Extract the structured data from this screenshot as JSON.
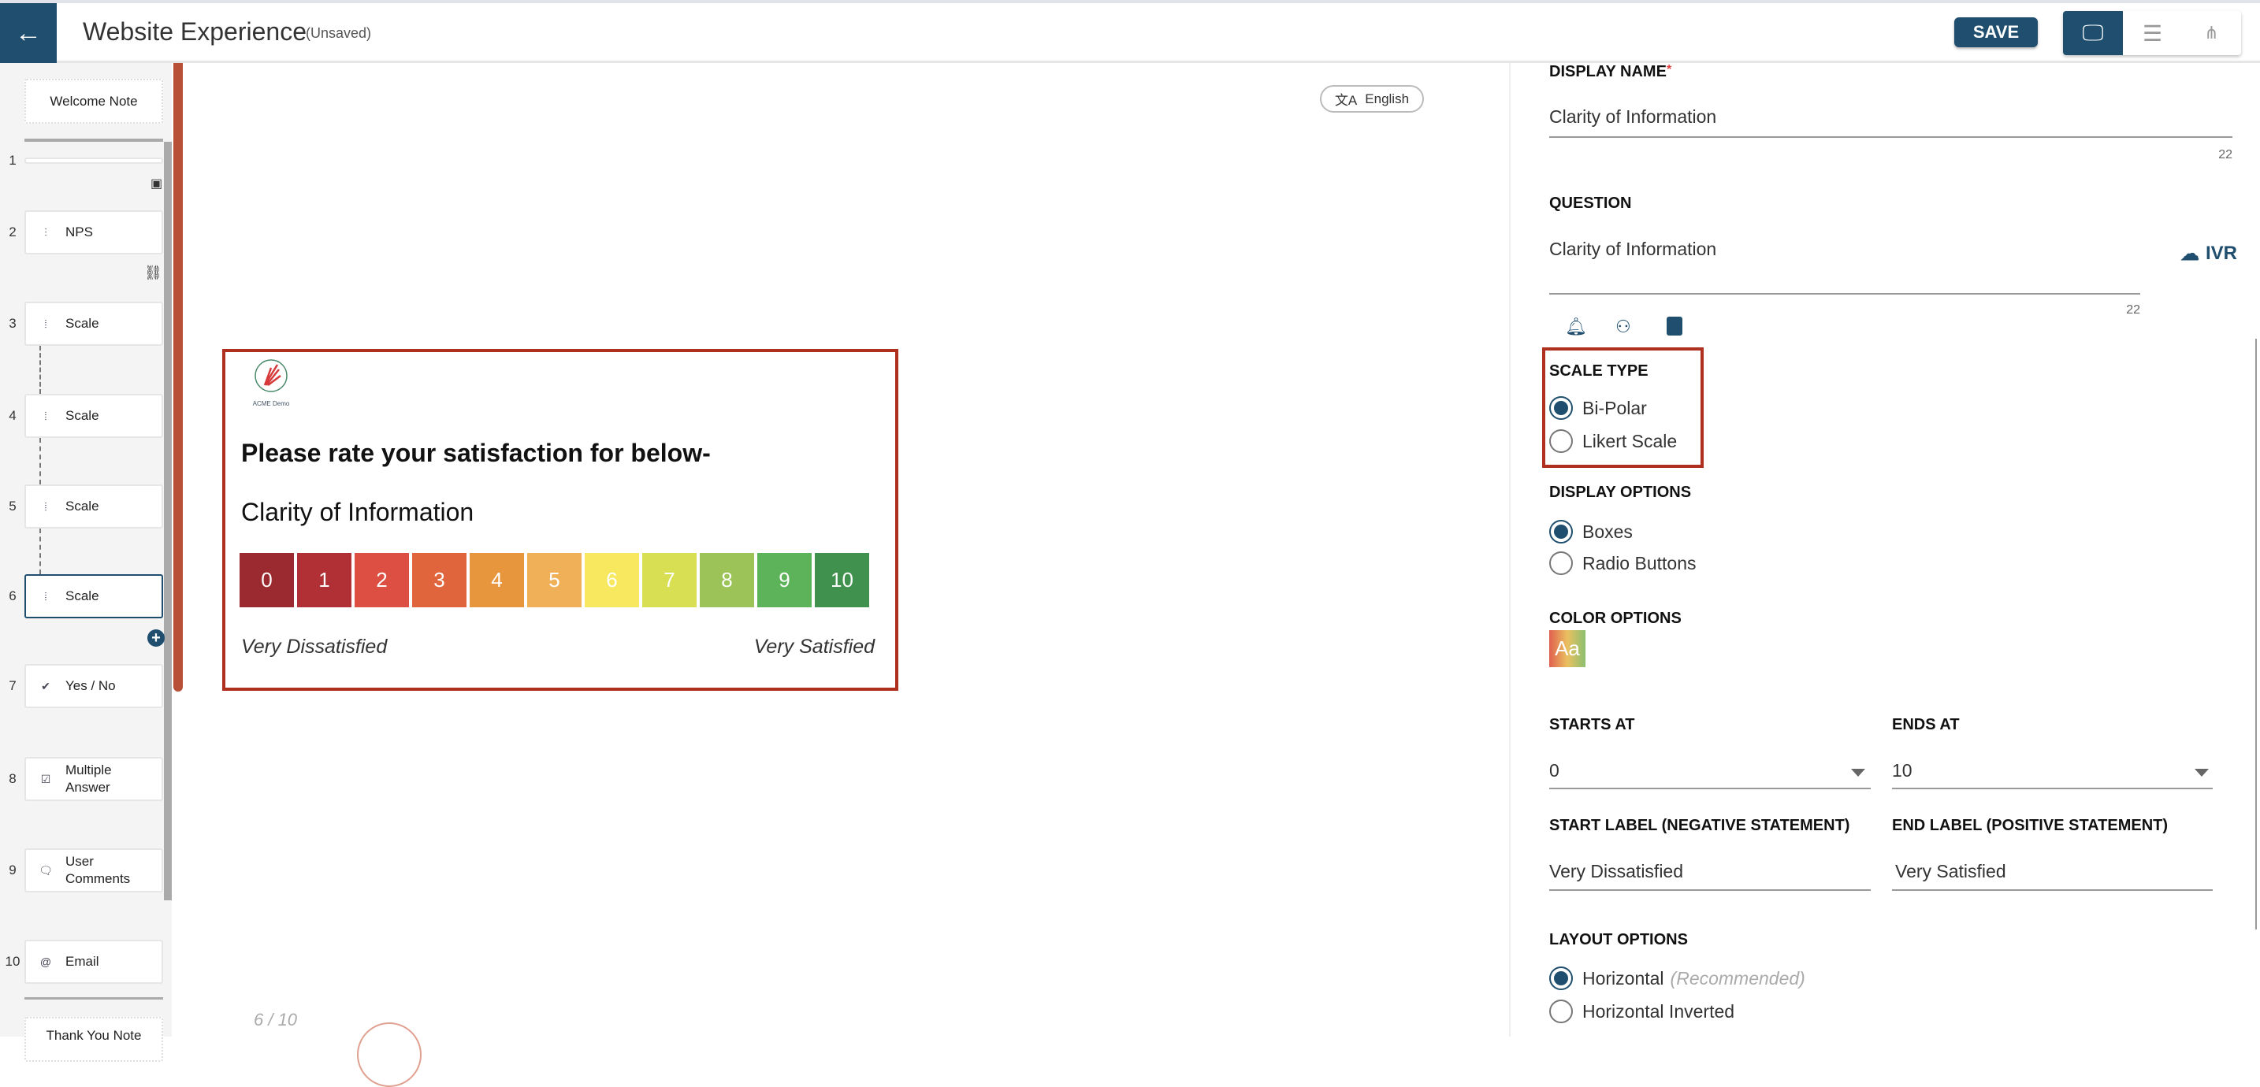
{
  "header": {
    "title": "Website Experience",
    "status": "(Unsaved)",
    "save_label": "SAVE",
    "views": [
      "desktop-icon",
      "list-icon",
      "sitemap-icon"
    ]
  },
  "sidebar": {
    "welcome": "Welcome Note",
    "items": [
      {
        "num": "1",
        "label": "",
        "icon": "blank"
      },
      {
        "num": "2",
        "label": "NPS",
        "icon": "nps-icon"
      },
      {
        "num": "3",
        "label": "Scale",
        "icon": "scale-icon"
      },
      {
        "num": "4",
        "label": "Scale",
        "icon": "scale-icon"
      },
      {
        "num": "5",
        "label": "Scale",
        "icon": "scale-icon"
      },
      {
        "num": "6",
        "label": "Scale",
        "icon": "scale-icon",
        "selected": true
      },
      {
        "num": "7",
        "label": "Yes / No",
        "icon": "check-badge-icon"
      },
      {
        "num": "8",
        "label": "Multiple Answer",
        "icon": "checklist-icon"
      },
      {
        "num": "9",
        "label": "User Comments",
        "icon": "comment-icon"
      },
      {
        "num": "10",
        "label": "Email",
        "icon": "at-icon"
      }
    ],
    "thankyou": "Thank You Note"
  },
  "preview": {
    "language": "English",
    "logo_text": "ACME Demo",
    "heading": "Please rate your satisfaction for below-",
    "question": "Clarity of Information",
    "scale": [
      "0",
      "1",
      "2",
      "3",
      "4",
      "5",
      "6",
      "7",
      "8",
      "9",
      "10"
    ],
    "scale_colors": [
      "#9a2a30",
      "#b03036",
      "#de4f43",
      "#e0653d",
      "#e8963e",
      "#f0b057",
      "#f7e85f",
      "#d9df52",
      "#9bc357",
      "#5cb35a",
      "#3f914d"
    ],
    "start_label": "Very Dissatisfied",
    "end_label": "Very Satisfied",
    "page": "6 / 10"
  },
  "panel": {
    "display_name_label": "DISPLAY NAME",
    "required": "*",
    "display_name": "Clarity of Information",
    "display_name_count": "22",
    "question_label": "QUESTION",
    "question": "Clarity of Information",
    "question_count": "22",
    "ivr": "IVR",
    "scale_type_label": "SCALE TYPE",
    "scale_types": [
      "Bi-Polar",
      "Likert Scale"
    ],
    "display_options_label": "DISPLAY OPTIONS",
    "display_options": [
      "Boxes",
      "Radio Buttons"
    ],
    "color_options_label": "COLOR OPTIONS",
    "color_swatch": "Aa",
    "starts_at_label": "STARTS AT",
    "starts_at": "0",
    "ends_at_label": "ENDS AT",
    "ends_at": "10",
    "start_label_label": "START LABEL (NEGATIVE STATEMENT)",
    "start_label": "Very Dissatisfied",
    "end_label_label": "END LABEL (POSITIVE STATEMENT)",
    "end_label": "Very Satisfied",
    "layout_options_label": "LAYOUT OPTIONS",
    "layout_options": [
      "Horizontal",
      "Horizontal Inverted"
    ],
    "recommended": "(Recommended)"
  },
  "accent": "#1f4e6e",
  "highlight": "#b03020"
}
